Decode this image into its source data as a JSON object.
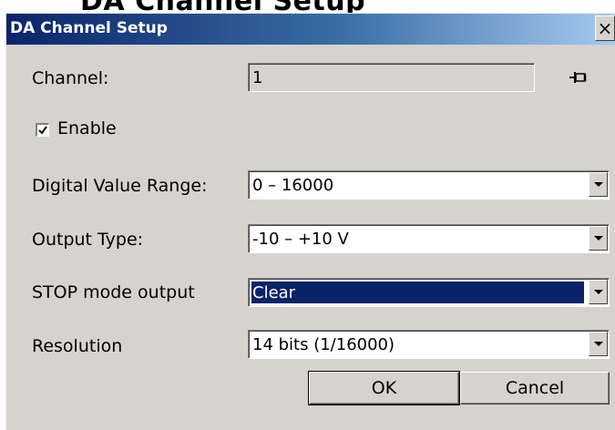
{
  "dialog": {
    "title": "DA Channel Setup",
    "close_label": "×"
  },
  "background_heading": "DA Channel Setup",
  "channel": {
    "label": "Channel:",
    "value": "1"
  },
  "enable": {
    "label": "Enable",
    "checked": true
  },
  "digital_value_range": {
    "label": "Digital Value Range:",
    "value": "0 – 16000"
  },
  "output_type": {
    "label": "Output Type:",
    "value": "-10 – +10 V"
  },
  "stop_mode_output": {
    "label": "STOP mode output",
    "value": "Clear"
  },
  "resolution": {
    "label": "Resolution",
    "value": "14 bits (1/16000)"
  },
  "buttons": {
    "ok": "OK",
    "cancel": "Cancel"
  },
  "icons": {
    "pin": "pin-icon",
    "dropdown": "chevron-down-icon",
    "check": "checkmark-icon"
  },
  "colors": {
    "title_start": "#0a246a",
    "title_end": "#a6caf0",
    "face": "#d6d3ce",
    "selection": "#0a246a"
  }
}
